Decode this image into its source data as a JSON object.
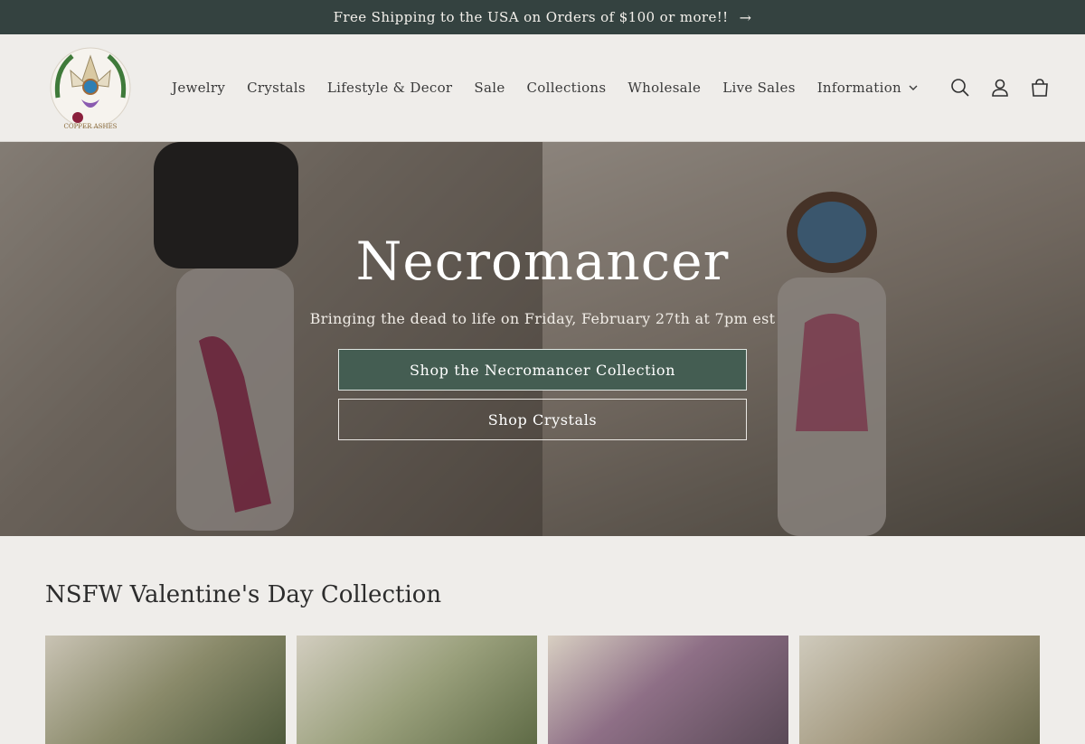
{
  "announcement": {
    "text": "Free Shipping to the USA on Orders of $100 or more!!",
    "arrow": "→"
  },
  "header": {
    "logo_text": "COPPER ASHES",
    "nav": [
      {
        "label": "Jewelry"
      },
      {
        "label": "Crystals"
      },
      {
        "label": "Lifestyle & Decor"
      },
      {
        "label": "Sale"
      },
      {
        "label": "Collections"
      },
      {
        "label": "Wholesale"
      },
      {
        "label": "Live Sales"
      },
      {
        "label": "Information",
        "has_dropdown": true
      }
    ],
    "icons": [
      "search-icon",
      "account-icon",
      "cart-icon"
    ]
  },
  "hero": {
    "title": "Necromancer",
    "subtitle": "Bringing the dead to life on Friday, February 27th at 7pm est",
    "primary_button": "Shop the Necromancer Collection",
    "secondary_button": "Shop Crystals"
  },
  "collection": {
    "title": "NSFW Valentine's Day Collection",
    "products": [
      {
        "image": "product-image-1"
      },
      {
        "image": "product-image-2"
      },
      {
        "image": "product-image-3"
      },
      {
        "image": "product-image-4"
      }
    ]
  },
  "colors": {
    "announcement_bg": "#344240",
    "page_bg": "#efedea",
    "primary_button_bg": "#445d52"
  }
}
